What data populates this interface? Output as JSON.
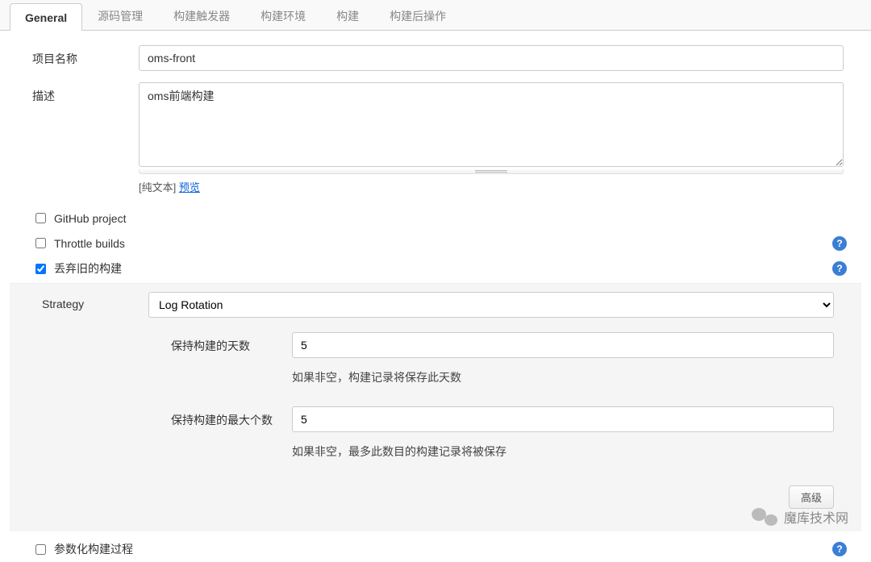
{
  "tabs": {
    "general": "General",
    "scm": "源码管理",
    "triggers": "构建触发器",
    "env": "构建环境",
    "build": "构建",
    "post": "构建后操作"
  },
  "form": {
    "projectNameLabel": "项目名称",
    "projectNameValue": "oms-front",
    "descriptionLabel": "描述",
    "descriptionValue": "oms前端构建",
    "formatPrefix": "[纯文本] ",
    "previewLink": "预览"
  },
  "checks": {
    "github": "GitHub project",
    "throttle": "Throttle builds",
    "discardOld": "丢弃旧的构建",
    "parameterized": "参数化构建过程"
  },
  "strategy": {
    "label": "Strategy",
    "selected": "Log Rotation",
    "daysLabel": "保持构建的天数",
    "daysValue": "5",
    "daysHelp": "如果非空，构建记录将保存此天数",
    "maxLabel": "保持构建的最大个数",
    "maxValue": "5",
    "maxHelp": "如果非空，最多此数目的构建记录将被保存"
  },
  "advancedButton": "高级",
  "watermark": "魔库技术网"
}
